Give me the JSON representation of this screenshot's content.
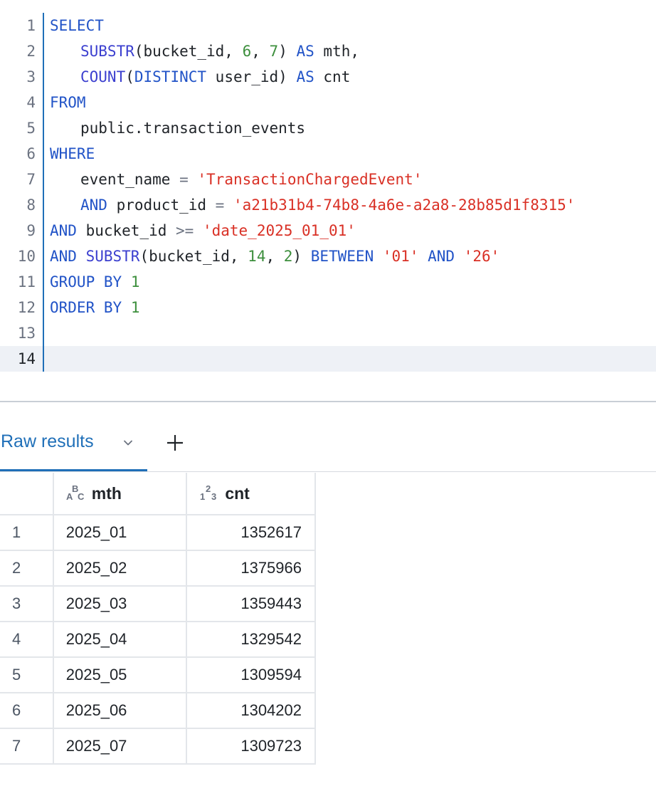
{
  "editor": {
    "line_numbers": [
      "1",
      "2",
      "3",
      "4",
      "5",
      "6",
      "7",
      "8",
      "9",
      "10",
      "11",
      "12",
      "13",
      "14"
    ],
    "lines": [
      [
        {
          "t": "SELECT",
          "c": "kw"
        }
      ],
      [
        {
          "t": "SUBSTR",
          "c": "fn"
        },
        {
          "t": "(bucket_id, ",
          "c": ""
        },
        {
          "t": "6",
          "c": "num"
        },
        {
          "t": ", ",
          "c": ""
        },
        {
          "t": "7",
          "c": "num"
        },
        {
          "t": ") ",
          "c": ""
        },
        {
          "t": "AS",
          "c": "kw"
        },
        {
          "t": " mth,",
          "c": ""
        }
      ],
      [
        {
          "t": "COUNT",
          "c": "fn"
        },
        {
          "t": "(",
          "c": ""
        },
        {
          "t": "DISTINCT",
          "c": "kw"
        },
        {
          "t": " user_id) ",
          "c": ""
        },
        {
          "t": "AS",
          "c": "kw"
        },
        {
          "t": " cnt",
          "c": ""
        }
      ],
      [
        {
          "t": "FROM",
          "c": "kw"
        }
      ],
      [
        {
          "t": "public.transaction_events",
          "c": ""
        }
      ],
      [
        {
          "t": "WHERE",
          "c": "kw"
        }
      ],
      [
        {
          "t": "event_name ",
          "c": ""
        },
        {
          "t": "=",
          "c": "op"
        },
        {
          "t": " ",
          "c": ""
        },
        {
          "t": "'TransactionChargedEvent'",
          "c": "str"
        }
      ],
      [
        {
          "t": "AND",
          "c": "kw"
        },
        {
          "t": " product_id ",
          "c": ""
        },
        {
          "t": "=",
          "c": "op"
        },
        {
          "t": " ",
          "c": ""
        },
        {
          "t": "'a21b31b4-74b8-4a6e-a2a8-28b85d1f8315'",
          "c": "str"
        }
      ],
      [
        {
          "t": "AND",
          "c": "kw"
        },
        {
          "t": " bucket_id ",
          "c": ""
        },
        {
          "t": ">=",
          "c": "op"
        },
        {
          "t": " ",
          "c": ""
        },
        {
          "t": "'date_2025_01_01'",
          "c": "str"
        }
      ],
      [
        {
          "t": "AND",
          "c": "kw"
        },
        {
          "t": " ",
          "c": ""
        },
        {
          "t": "SUBSTR",
          "c": "fn"
        },
        {
          "t": "(bucket_id, ",
          "c": ""
        },
        {
          "t": "14",
          "c": "num"
        },
        {
          "t": ", ",
          "c": ""
        },
        {
          "t": "2",
          "c": "num"
        },
        {
          "t": ") ",
          "c": ""
        },
        {
          "t": "BETWEEN",
          "c": "kw"
        },
        {
          "t": " ",
          "c": ""
        },
        {
          "t": "'01'",
          "c": "str"
        },
        {
          "t": " ",
          "c": ""
        },
        {
          "t": "AND",
          "c": "kw"
        },
        {
          "t": " ",
          "c": ""
        },
        {
          "t": "'26'",
          "c": "str"
        }
      ],
      [
        {
          "t": "GROUP BY",
          "c": "kw"
        },
        {
          "t": " ",
          "c": ""
        },
        {
          "t": "1",
          "c": "num"
        }
      ],
      [
        {
          "t": "ORDER BY",
          "c": "kw"
        },
        {
          "t": " ",
          "c": ""
        },
        {
          "t": "1",
          "c": "num"
        }
      ],
      [],
      []
    ],
    "indented_lines": [
      1,
      2,
      4,
      6,
      7
    ],
    "active_line": 13,
    "colors": {
      "keyword": "#2153c7",
      "function": "#3b3fcf",
      "number": "#3d8f3d",
      "string": "#d93025",
      "gutter_border": "#1f6fb8",
      "active_line_bg": "#eef1f6"
    }
  },
  "results": {
    "tab_label": "Raw results",
    "chevron_icon": "chevron-down-icon",
    "add_icon": "plus-icon",
    "accent_color": "#1f6fb8",
    "columns": [
      {
        "name": "mth",
        "type_icon": "string-type-icon"
      },
      {
        "name": "cnt",
        "type_icon": "number-type-icon"
      }
    ],
    "rows": [
      {
        "idx": "1",
        "mth": "2025_01",
        "cnt": "1352617"
      },
      {
        "idx": "2",
        "mth": "2025_02",
        "cnt": "1375966"
      },
      {
        "idx": "3",
        "mth": "2025_03",
        "cnt": "1359443"
      },
      {
        "idx": "4",
        "mth": "2025_04",
        "cnt": "1329542"
      },
      {
        "idx": "5",
        "mth": "2025_05",
        "cnt": "1309594"
      },
      {
        "idx": "6",
        "mth": "2025_06",
        "cnt": "1304202"
      },
      {
        "idx": "7",
        "mth": "2025_07",
        "cnt": "1309723"
      }
    ]
  }
}
